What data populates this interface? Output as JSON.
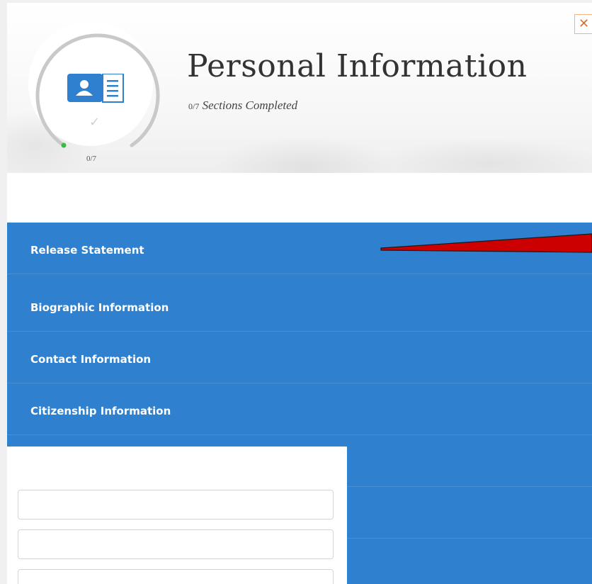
{
  "header": {
    "title": "Personal Information",
    "subtitle_count": "0/7",
    "subtitle_text": "Sections Completed",
    "close_label": "✕"
  },
  "progress": {
    "label": "0/7",
    "completed": 0,
    "total": 7,
    "fraction": 0
  },
  "menu": {
    "items": [
      {
        "label": "Release Statement"
      },
      {
        "label": "Biographic Information"
      },
      {
        "label": "Contact Information"
      },
      {
        "label": "Citizenship Information"
      },
      {
        "label": ""
      },
      {
        "label": ""
      }
    ]
  },
  "form": {
    "fields": [
      {
        "value": "",
        "placeholder": ""
      },
      {
        "value": "",
        "placeholder": ""
      },
      {
        "value": "",
        "placeholder": ""
      }
    ]
  },
  "colors": {
    "menu_bg": "#2f80ce",
    "accent_card": "#2f80ce",
    "progress_dot": "#3dbb3d",
    "close_icon": "#e86a1e",
    "arrow": "#cc0000"
  },
  "icons": {
    "card": "contact-card-icon",
    "check": "checkmark-icon",
    "close": "close-icon",
    "dot": "progress-dot-icon"
  }
}
